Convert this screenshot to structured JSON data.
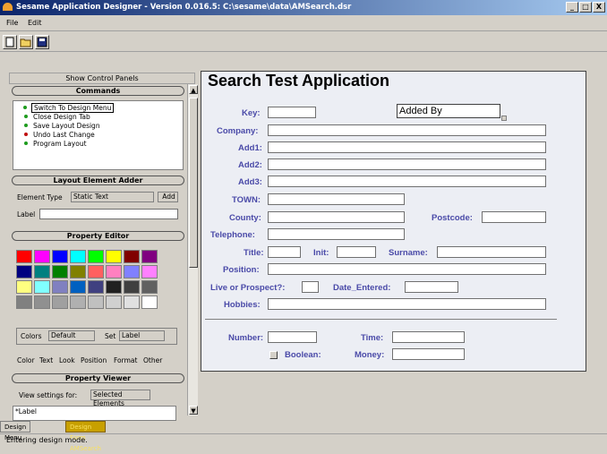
{
  "window": {
    "title": "Sesame Application Designer - Version 0.016.5: C:\\sesame\\data\\AMSearch.dsr",
    "buttons": [
      "_",
      "□",
      "X"
    ]
  },
  "menu": [
    "File",
    "Edit"
  ],
  "toolbar": {
    "icons": [
      "new-file-icon",
      "open-folder-icon",
      "save-disk-icon"
    ]
  },
  "left": {
    "show_control_panels": "Show Control Panels",
    "commands": {
      "title": "Commands",
      "items": [
        {
          "label": "Switch To Design Menu",
          "color": "#1e9c1e"
        },
        {
          "label": "Close Design Tab",
          "color": "#1e9c1e"
        },
        {
          "label": "Save Layout Design",
          "color": "#1e9c1e"
        },
        {
          "label": "Undo Last Change",
          "color": "#c01010"
        },
        {
          "label": "Program Layout",
          "color": "#1e9c1e"
        }
      ]
    },
    "adder": {
      "title": "Layout Element Adder",
      "element_type_label": "Element Type",
      "element_type_value": "Static Text",
      "add_button": "Add",
      "label_label": "Label",
      "label_value": ""
    },
    "property_editor": {
      "title": "Property Editor",
      "palette": [
        "#ff0000",
        "#ff00ff",
        "#0000ff",
        "#00ffff",
        "#00ff00",
        "#ffff00",
        "#800000",
        "#800080",
        "#000080",
        "#008080",
        "#008000",
        "#808000",
        "#ff6060",
        "#ff80c0",
        "#8080ff",
        "#ff80ff",
        "#ffff80",
        "#80ffff",
        "#8080c0",
        "#0060c0",
        "#404080",
        "#202020",
        "#404040",
        "#606060",
        "#808080",
        "#909090",
        "#a0a0a0",
        "#b0b0b0",
        "#c0c0c0",
        "#d0d0d0",
        "#e0e0e0",
        "#ffffff"
      ],
      "colors_label": "Colors",
      "colors_value": "Default",
      "set_label": "Set",
      "set_value": "Label",
      "tabs": [
        "Color",
        "Text",
        "Look",
        "Position",
        "Format",
        "Other"
      ]
    },
    "viewer": {
      "title": "Property Viewer",
      "view_for_label": "View settings for:",
      "view_for_value": "Selected Elements",
      "rows": [
        "*Label"
      ]
    }
  },
  "design": {
    "title": "Search Test Application",
    "fields": [
      {
        "label": "Key:",
        "value": ""
      },
      {
        "label": "Added By",
        "value": "Added By"
      },
      {
        "label": "Company:"
      },
      {
        "label": "Add1:"
      },
      {
        "label": "Add2:"
      },
      {
        "label": "Add3:"
      },
      {
        "label": "TOWN:"
      },
      {
        "label": "County:"
      },
      {
        "label": "Postcode:"
      },
      {
        "label": "Telephone:"
      },
      {
        "label": "Title:"
      },
      {
        "label": "Init:"
      },
      {
        "label": "Surname:"
      },
      {
        "label": "Position:"
      },
      {
        "label": "Live or Prospect?:"
      },
      {
        "label": "Date_Entered:"
      },
      {
        "label": "Hobbies:"
      },
      {
        "label": "Number:"
      },
      {
        "label": "Time:"
      },
      {
        "label": "Boolean:"
      },
      {
        "label": "Money:"
      }
    ]
  },
  "bottom_tabs": [
    "Design Menu",
    "Design Form AMSearch"
  ],
  "status": "Entering design mode."
}
